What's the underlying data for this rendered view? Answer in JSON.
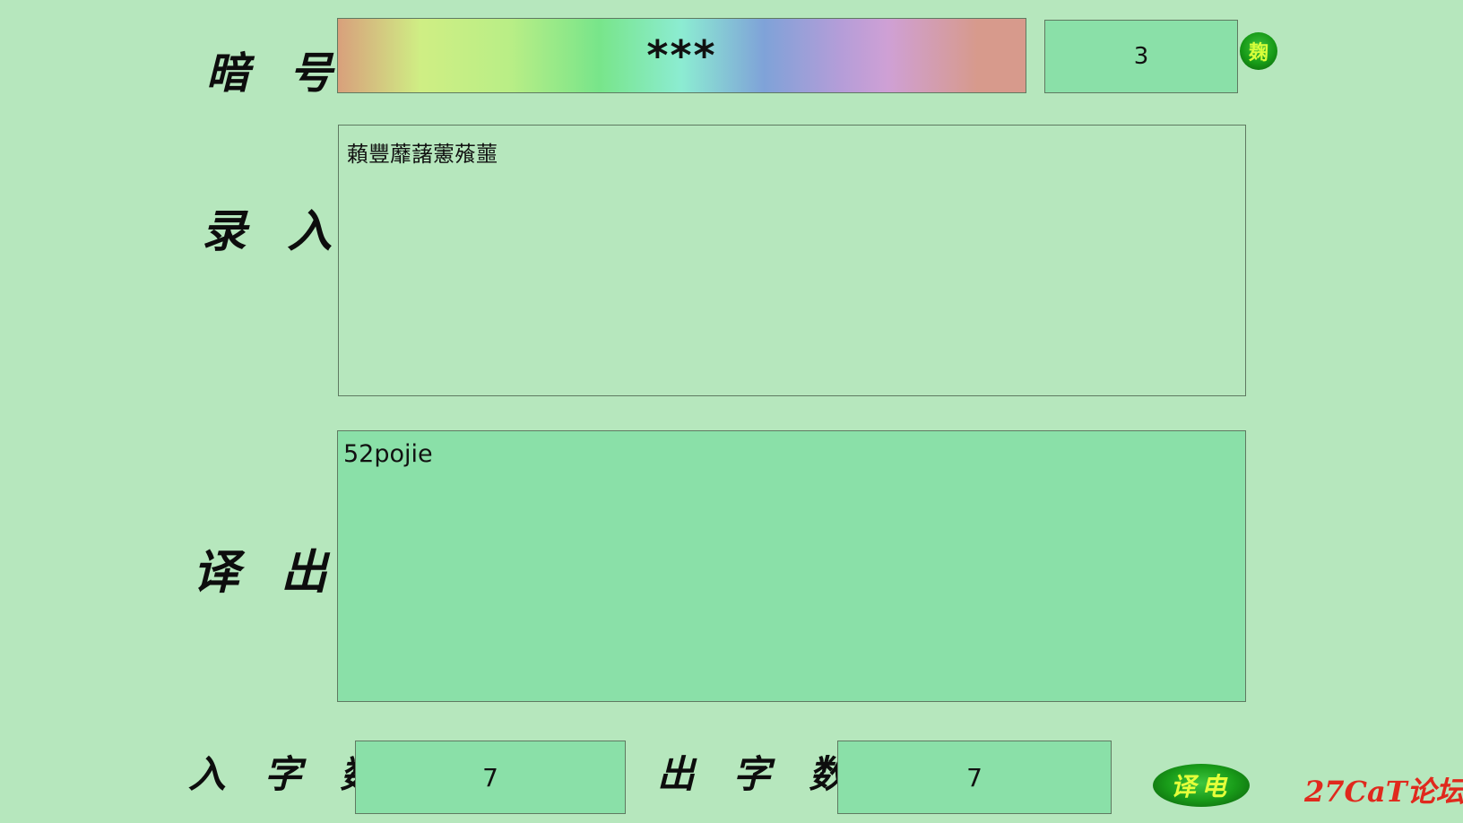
{
  "labels": {
    "code": "暗 号",
    "input": "录 入",
    "output": "译 出",
    "in_count": "入 字 数",
    "out_count": "出 字 数"
  },
  "code_field": {
    "value": "***"
  },
  "key_field": {
    "value": "3"
  },
  "round_button": {
    "label": "麹"
  },
  "input_text": "藾豐蘼藷藼蕵蘁",
  "output_text": "52pojie",
  "in_count_value": "7",
  "out_count_value": "7",
  "translate_button": {
    "label": "译电"
  },
  "watermark": "27CaT论坛",
  "colors": {
    "background": "#b6e7bd",
    "field_green": "#8ae0a8",
    "button_green": "#199c19",
    "watermark_red": "#e0291d"
  }
}
